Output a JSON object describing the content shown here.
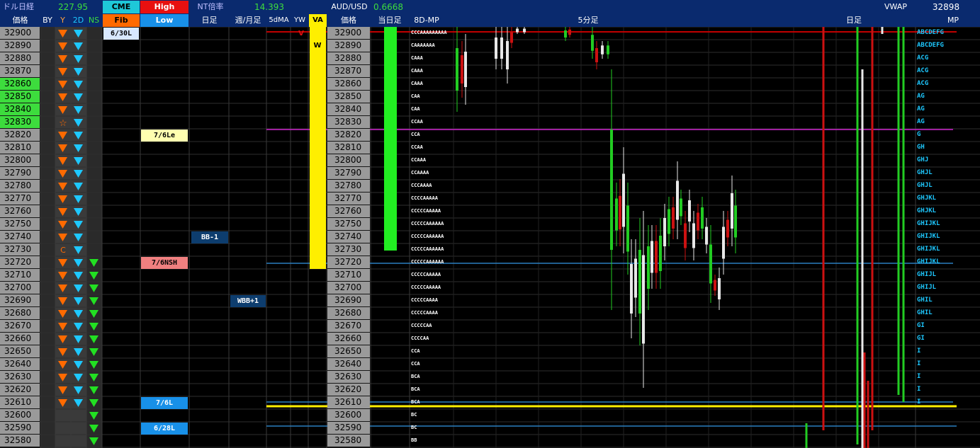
{
  "header": {
    "nikkei_label": "ドル日経",
    "nikkei_value": "227.95",
    "cme_label": "CME",
    "high_label": "High",
    "nt_label": "NT倍率",
    "nt_value": "14.393",
    "aud_label": "AUD/USD",
    "aud_value": "0.6668",
    "vwap_label": "VWAP",
    "vwap_value": "32898",
    "fib_label": "Fib",
    "low_label": "Low",
    "col_price": "価格",
    "col_by": "BY",
    "col_y": "Y",
    "col_2d": "2D",
    "col_ns": "NS",
    "col_daily": "日足",
    "col_weekly": "週/月足",
    "col_5dma": "5dMA",
    "col_yw": "YW",
    "col_va": "VA",
    "col_price2": "価格",
    "col_today": "当日足",
    "col_8dmp": "8D-MP",
    "col_5min": "5分足",
    "col_daily2": "日足",
    "col_mp": "MP"
  },
  "prices": [
    "32900",
    "32890",
    "32880",
    "32870",
    "32860",
    "32850",
    "32840",
    "32830",
    "32820",
    "32810",
    "32800",
    "32790",
    "32780",
    "32770",
    "32760",
    "32750",
    "32740",
    "32730",
    "32720",
    "32710",
    "32700",
    "32690",
    "32680",
    "32670",
    "32660",
    "32650",
    "32640",
    "32630",
    "32620",
    "32610",
    "32600",
    "32590",
    "32580"
  ],
  "y_markers": [
    "tri",
    "tri",
    "tri",
    "tri",
    "tri",
    "tri",
    "tri",
    "star",
    "tri",
    "tri",
    "tri",
    "tri",
    "tri",
    "tri",
    "tri",
    "tri",
    "tri",
    "C",
    "tri",
    "tri",
    "tri",
    "tri",
    "tri",
    "tri",
    "tri",
    "tri",
    "tri",
    "tri",
    "tri",
    "tri",
    "",
    "",
    ""
  ],
  "labels": {
    "fib_630": "6/30L",
    "fib_76le": "7/6Le",
    "fib_76nsh": "7/6NSH",
    "fib_76l": "7/6L",
    "fib_628": "6/28L",
    "bb1": "BB-1",
    "wbb1": "WBB+1",
    "yw_v": "V",
    "yw_w": "W"
  },
  "tpo": [
    "CCCAAAAAAAAA",
    "CAAAAAAA",
    "CAAA",
    "CAAA",
    "CAAA",
    "CAA",
    "CAA",
    "CCAA",
    "CCA",
    "CCAA",
    "CCAAA",
    "CCAAAA",
    "CCCAAAA",
    "CCCCAAAAA",
    "CCCCCAAAAA",
    "CCCCCAAAAAA",
    "CCCCCAAAAAA",
    "CCCCCAAAAAA",
    "CCCCCAAAAAA",
    "CCCCCAAAAA",
    "CCCCCAAAAA",
    "CCCCCAAAA",
    "CCCCCAAAA",
    "CCCCCAA",
    "CCCCAA",
    "CCA",
    "CCA",
    "BCA",
    "BCA",
    "BCA",
    "BC",
    "BC",
    "BB"
  ],
  "mp": [
    "ABCDEFG",
    "ABCDEFG",
    "ACG",
    "ACG",
    "ACG",
    "AG",
    "AG",
    "AG",
    "G",
    "GH",
    "GHJ",
    "GHJL",
    "GHJL",
    "GHJKL",
    "GHJKL",
    "GHIJKL",
    "GHIJKL",
    "GHIJKL",
    "GHIJKL",
    "GHIJL",
    "GHIJL",
    "GHIL",
    "GHIL",
    "GI",
    "GI",
    "I",
    "I",
    "I",
    "I",
    "I",
    "",
    "",
    ""
  ],
  "colors": {
    "header_bg": "#0a2a6e",
    "price_bg": "#9a9a9a",
    "green_price": "#3ddc3d",
    "orange": "#ff6a00",
    "cyan": "#1ec8ff",
    "green": "#22e022",
    "yellow": "#ffef00",
    "red_line": "#c00000",
    "magenta": "#cc22cc",
    "blue_line": "#2a7fc0"
  }
}
